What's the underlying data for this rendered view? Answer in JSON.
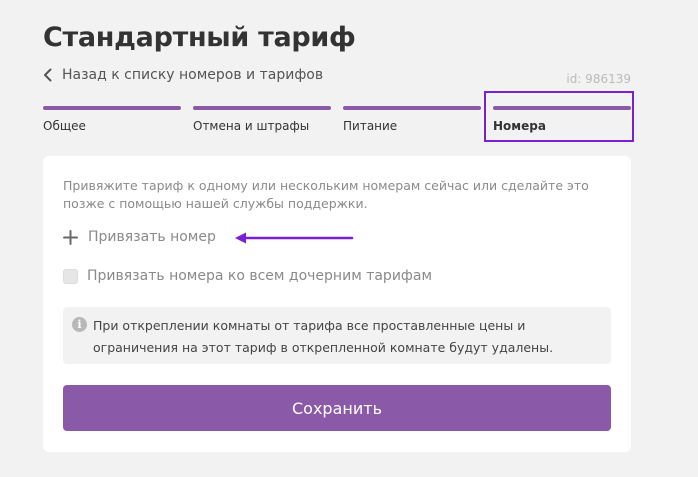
{
  "header": {
    "title": "Стандартный тариф",
    "back_label": "Назад к списку номеров и тарифов",
    "tariff_id": "id: 986139"
  },
  "steps": [
    {
      "label": "Общее",
      "active": false
    },
    {
      "label": "Отмена и штрафы",
      "active": false
    },
    {
      "label": "Питание",
      "active": false
    },
    {
      "label": "Номера",
      "active": true
    }
  ],
  "card": {
    "intro": "Привяжите тариф к одному или нескольким номерам сейчас или сделайте это позже с помощью нашей службы поддержки.",
    "link_room_label": "Привязать номер",
    "checkbox_label": "Привязать номера ко всем дочерним тарифам",
    "checkbox_checked": false,
    "info_text": "При откреплении комнаты от тарифа все проставленные цены и ограничения на этот тариф в открепленной комнате будут удалены.",
    "save_label": "Сохранить"
  },
  "colors": {
    "accent": "#8a5aa8",
    "highlight": "#7a1fd6",
    "background": "#f2f2f2"
  },
  "icons": {
    "back": "chevron-left-icon",
    "add": "plus-icon",
    "info": "info-icon",
    "annotation": "arrow-left-icon"
  }
}
